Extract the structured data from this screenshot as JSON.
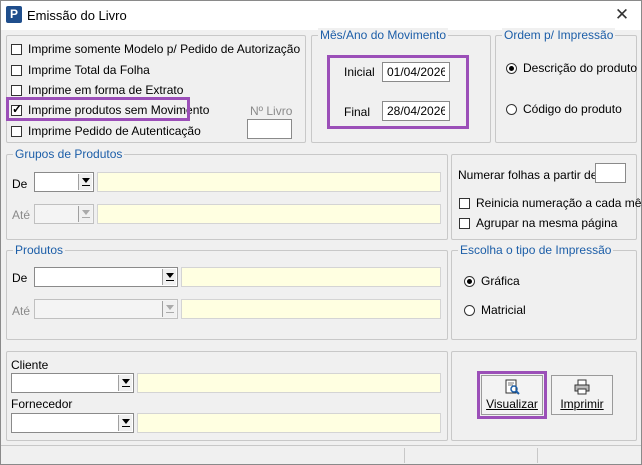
{
  "window": {
    "title": "Emissão do Livro",
    "icon_letter": "P"
  },
  "options": {
    "items": [
      {
        "label": "Imprime somente Modelo p/ Pedido de Autorização",
        "checked": false
      },
      {
        "label": "Imprime Total da Folha",
        "checked": false
      },
      {
        "label": "Imprime em forma de Extrato",
        "checked": false
      },
      {
        "label": "Imprime produtos sem Movimento",
        "checked": true
      },
      {
        "label": "Imprime Pedido de Autenticação",
        "checked": false
      }
    ],
    "num_livro_label": "Nº Livro",
    "num_livro_value": ""
  },
  "periodo": {
    "legend": "Mês/Ano do Movimento",
    "inicial_label": "Inicial",
    "inicial_value": "01/04/2026",
    "final_label": "Final",
    "final_value": "28/04/2026"
  },
  "ordem": {
    "legend": "Ordem p/ Impressão",
    "opt1": "Descrição do produto",
    "opt2": "Código do produto",
    "selected": "opt1"
  },
  "grupos": {
    "legend": "Grupos de Produtos",
    "de_label": "De",
    "ate_label": "Até",
    "de_code": "",
    "de_desc": "",
    "ate_code": "",
    "ate_desc": ""
  },
  "numeracao": {
    "label": "Numerar folhas a partir de",
    "value": "",
    "reinicia": "Reinicia numeração a cada mês",
    "agrupar": "Agrupar na mesma página"
  },
  "produtos": {
    "legend": "Produtos",
    "de_label": "De",
    "ate_label": "Até"
  },
  "tipo": {
    "legend": "Escolha o tipo de Impressão",
    "opt1": "Gráfica",
    "opt2": "Matricial",
    "selected": "opt1"
  },
  "cliente_label": "Cliente",
  "fornecedor_label": "Fornecedor",
  "buttons": {
    "visualizar": "Visualizar",
    "imprimir": "Imprimir"
  },
  "colors": {
    "highlight": "#9b4fb8",
    "legend": "#1c5ea8",
    "field_yellow": "#ffffe1"
  }
}
